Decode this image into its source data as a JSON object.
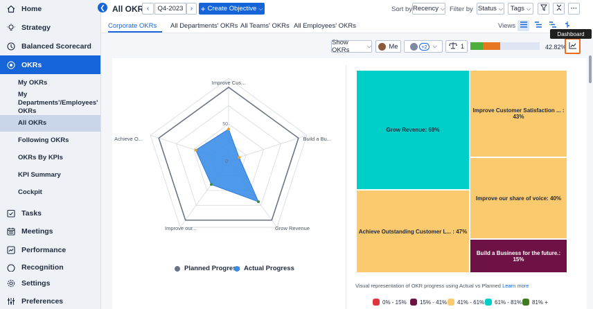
{
  "sidebar": {
    "items": [
      {
        "label": "Home",
        "icon": "home-icon"
      },
      {
        "label": "Strategy",
        "icon": "bulb-icon"
      },
      {
        "label": "Balanced Scorecard",
        "icon": "scorecard-icon"
      },
      {
        "label": "OKRs",
        "icon": "target-icon"
      },
      {
        "label": "Tasks",
        "icon": "tasks-icon"
      },
      {
        "label": "Meetings",
        "icon": "calendar-icon"
      },
      {
        "label": "Performance",
        "icon": "performance-icon"
      },
      {
        "label": "Recognition",
        "icon": "recognition-icon"
      },
      {
        "label": "Settings",
        "icon": "gear-icon"
      },
      {
        "label": "Preferences",
        "icon": "sliders-icon"
      }
    ],
    "okr_subitems": [
      "My OKRs",
      "My Departments'/Employees' OKRs",
      "All OKRs",
      "Following OKRs",
      "OKRs By KPIs",
      "KPI Summary",
      "Cockpit"
    ]
  },
  "topbar": {
    "title": "All OKRs",
    "period": "Q4-2023",
    "create_label": "Create Objective",
    "sort_label": "Sort by",
    "sort_value": "Recency",
    "filter_label": "Filter by",
    "status_value": "Status",
    "tags_value": "Tags"
  },
  "tabs": [
    "Corporate OKRs",
    "All Departments' OKRs",
    "All Teams' OKRs",
    "All Employees' OKRs"
  ],
  "views_label": "Views",
  "tooltip": "Dashboard",
  "filters": {
    "show_okrs": "Show OKRs",
    "me": "Me",
    "avatars_extra": "+2",
    "alignment_count": "1",
    "progress_text": "42.82%",
    "progress_segments": [
      {
        "color": "#4caf3a",
        "fraction": 0.18
      },
      {
        "color": "#e87722",
        "fraction": 0.25
      }
    ]
  },
  "radar": {
    "axis_labels": [
      "Improve Cus...",
      "Build a Bu...",
      "Grow Revenue",
      "Improve our...",
      "Achieve O..."
    ],
    "tick_labels": [
      "50",
      "0"
    ],
    "planned_label": "Planned Progress",
    "actual_label": "Actual Progress",
    "planned_color": "#6b7385",
    "actual_color": "#3b8ee8"
  },
  "chart_data": {
    "type": "radar",
    "categories": [
      "Improve Cus...",
      "Build a Bu...",
      "Grow Revenue",
      "Improve our...",
      "Achieve O..."
    ],
    "series": [
      {
        "name": "Planned Progress",
        "values": [
          100,
          100,
          100,
          100,
          100
        ]
      },
      {
        "name": "Actual Progress",
        "values": [
          43,
          15,
          69,
          40,
          47
        ]
      }
    ],
    "ylim": [
      0,
      100
    ]
  },
  "treemap": {
    "tiles": [
      {
        "label": "Grow Revenue: 69%",
        "color": "#00cec9"
      },
      {
        "label": "Improve Customer Satisfaction ... : 43%",
        "color": "#fbc96e"
      },
      {
        "label": "Improve our share of voice: 40%",
        "color": "#fbc96e"
      },
      {
        "label": "Achieve Outstanding Customer L... : 47%",
        "color": "#fbc96e"
      },
      {
        "label": "Build a Business for the future.: 15%",
        "color": "#6e1245"
      }
    ],
    "note": "Visual representation of OKR progress using Actual vs Planned",
    "note_link": "Learn more",
    "ranges": [
      {
        "label": "0% - 15%",
        "color": "#e0343c"
      },
      {
        "label": "15% - 41%",
        "color": "#6e1245"
      },
      {
        "label": "41% - 61%",
        "color": "#fbc96e"
      },
      {
        "label": "61% - 81%",
        "color": "#00cec9"
      },
      {
        "label": "81% +",
        "color": "#3d7a1e"
      }
    ]
  }
}
